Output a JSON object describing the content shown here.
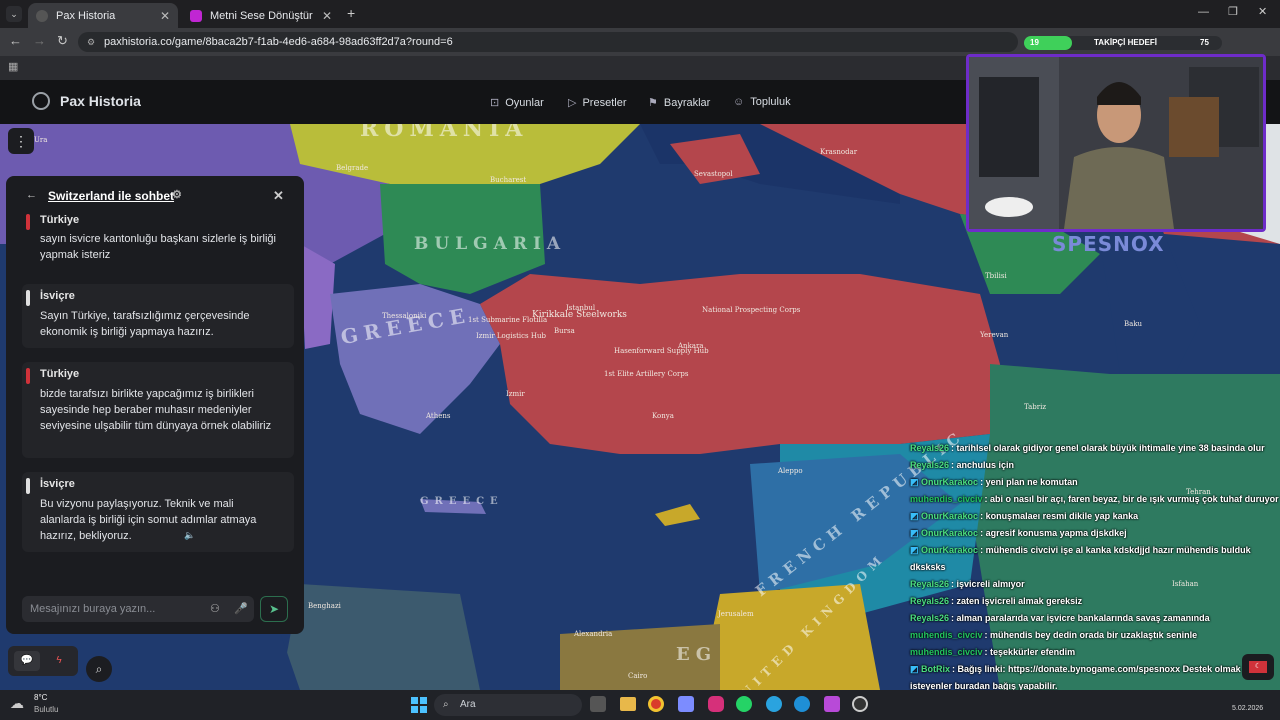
{
  "browser": {
    "tabs": [
      {
        "title": "Pax Historia",
        "active": true
      },
      {
        "title": "Metni Sese Dönüştür",
        "active": false
      }
    ],
    "url": "paxhistoria.co/game/8baca2b7-f1ab-4ed6-a684-98ad63ff2d7a?round=6"
  },
  "app": {
    "name": "Pax Historia",
    "nav": [
      {
        "label": "Oyunlar",
        "icon": "gamepad-icon"
      },
      {
        "label": "Presetler",
        "icon": "play-icon"
      },
      {
        "label": "Bayraklar",
        "icon": "flag-icon"
      },
      {
        "label": "Topluluk",
        "icon": "users-icon"
      }
    ]
  },
  "map": {
    "region_labels": [
      "ROMANIA",
      "BULGARIA",
      "GREECE",
      "GREECE",
      "FRENCH REPUBLIC",
      "UNITED KINGDOM",
      "EG"
    ],
    "cities": [
      "Belgrade",
      "Bucharest",
      "Sevastopol",
      "Krasnodar",
      "Thessaloniki",
      "Istanbul",
      "Bursa",
      "Ankara",
      "1st Submarine Flotilla",
      "Kirikkale Steelworks",
      "Izmir Logistics Hub",
      "Hasenforward Supply Hub",
      "1st Elite Artillery Corps",
      "National Prospecting Corps",
      "Izmir",
      "Athens",
      "Konya",
      "Aleppo",
      "Tbilisi",
      "Yerevan",
      "Baku",
      "Tabriz",
      "Tehran",
      "Isfahan",
      "Benghazi",
      "Alexandria",
      "Cairo",
      "Jerusalem",
      "Ura"
    ]
  },
  "chat": {
    "title": "Switzerland ile sohbet",
    "messages": [
      {
        "sender": "Türkiye",
        "color": "#d0323a",
        "text": "sayın isvicre kantonluğu başkanı sizlerle iş birliği yapmak isteriz"
      },
      {
        "sender": "İsviçre",
        "color": "#e0e0e0",
        "text": "Sayın Türkiye, tarafsızlığımız çerçevesinde ekonomik iş birliği yapmaya hazırız."
      },
      {
        "sender": "Türkiye",
        "color": "#d0323a",
        "text": "bizde tarafsızı birlikte yapcağımız iş birlikleri sayesinde hep beraber muhasır medeniyler seviyesine ulşabilir tüm dünyaya örnek olabiliriz"
      },
      {
        "sender": "İsviçre",
        "color": "#e0e0e0",
        "text": "Bu vizyonu paylaşıyoruz. Teknik ve mali alanlarda iş birliği için somut adımlar atmaya hazırız, bekliyoruz."
      }
    ],
    "input_placeholder": "Mesajınızı buraya yazın..."
  },
  "stream": {
    "goal_label": "TAKİPÇİ HEDEFİ",
    "goal_current": "19",
    "goal_target": "75",
    "brand": "SPESNOX",
    "chat": [
      {
        "user": "Reyals26",
        "color": "#4ade80",
        "badge": false,
        "text": "tarihlsel olarak gidiyor genel olarak büyük ihtimalle yine 38 basinda olur"
      },
      {
        "user": "Reyals26",
        "color": "#4ade80",
        "badge": false,
        "text": "anchulus için"
      },
      {
        "user": "OnurKarakoc",
        "color": "#4ade80",
        "badge": true,
        "text": "yeni plan ne komutan"
      },
      {
        "user": "muhendis_civciv",
        "color": "#22c55e",
        "badge": false,
        "text": "abi o nasıl bir açı, faren beyaz, bir de ışık vurmuş çok tuhaf duruyor"
      },
      {
        "user": "OnurKarakoc",
        "color": "#4ade80",
        "badge": true,
        "text": "konuşmalaeı resmi dikile yap kanka"
      },
      {
        "user": "OnurKarakoc",
        "color": "#4ade80",
        "badge": true,
        "text": "agresif konusma yapma djskdkej"
      },
      {
        "user": "OnurKarakoc",
        "color": "#4ade80",
        "badge": true,
        "text": "mühendis civcivi işe al kanka kdskdjjd hazır mühendis bulduk dksksks"
      },
      {
        "user": "Reyals26",
        "color": "#4ade80",
        "badge": false,
        "text": "işvicreli almıyor"
      },
      {
        "user": "Reyals26",
        "color": "#4ade80",
        "badge": false,
        "text": "zaten işvicreli almak gereksiz"
      },
      {
        "user": "Reyals26",
        "color": "#4ade80",
        "badge": false,
        "text": "alman paralarıda var işvicre bankalarında savaş zamanında"
      },
      {
        "user": "muhendis_civciv",
        "color": "#22c55e",
        "badge": false,
        "text": "mühendis bey dedin orada bir uzaklaştık seninle"
      },
      {
        "user": "muhendis_civciv",
        "color": "#22c55e",
        "badge": false,
        "text": "teşekkürler efendim"
      },
      {
        "user": "BotRix",
        "color": "#4ade80",
        "badge": true,
        "text": "Bağış linki: https://donate.bynogame.com/spesnoxx Destek olmak isteyenler buradan bağış yapabilir."
      }
    ]
  },
  "taskbar": {
    "weather_temp": "8°C",
    "weather_desc": "Bulutlu",
    "search_label": "Ara",
    "date": "5.02.2026"
  }
}
